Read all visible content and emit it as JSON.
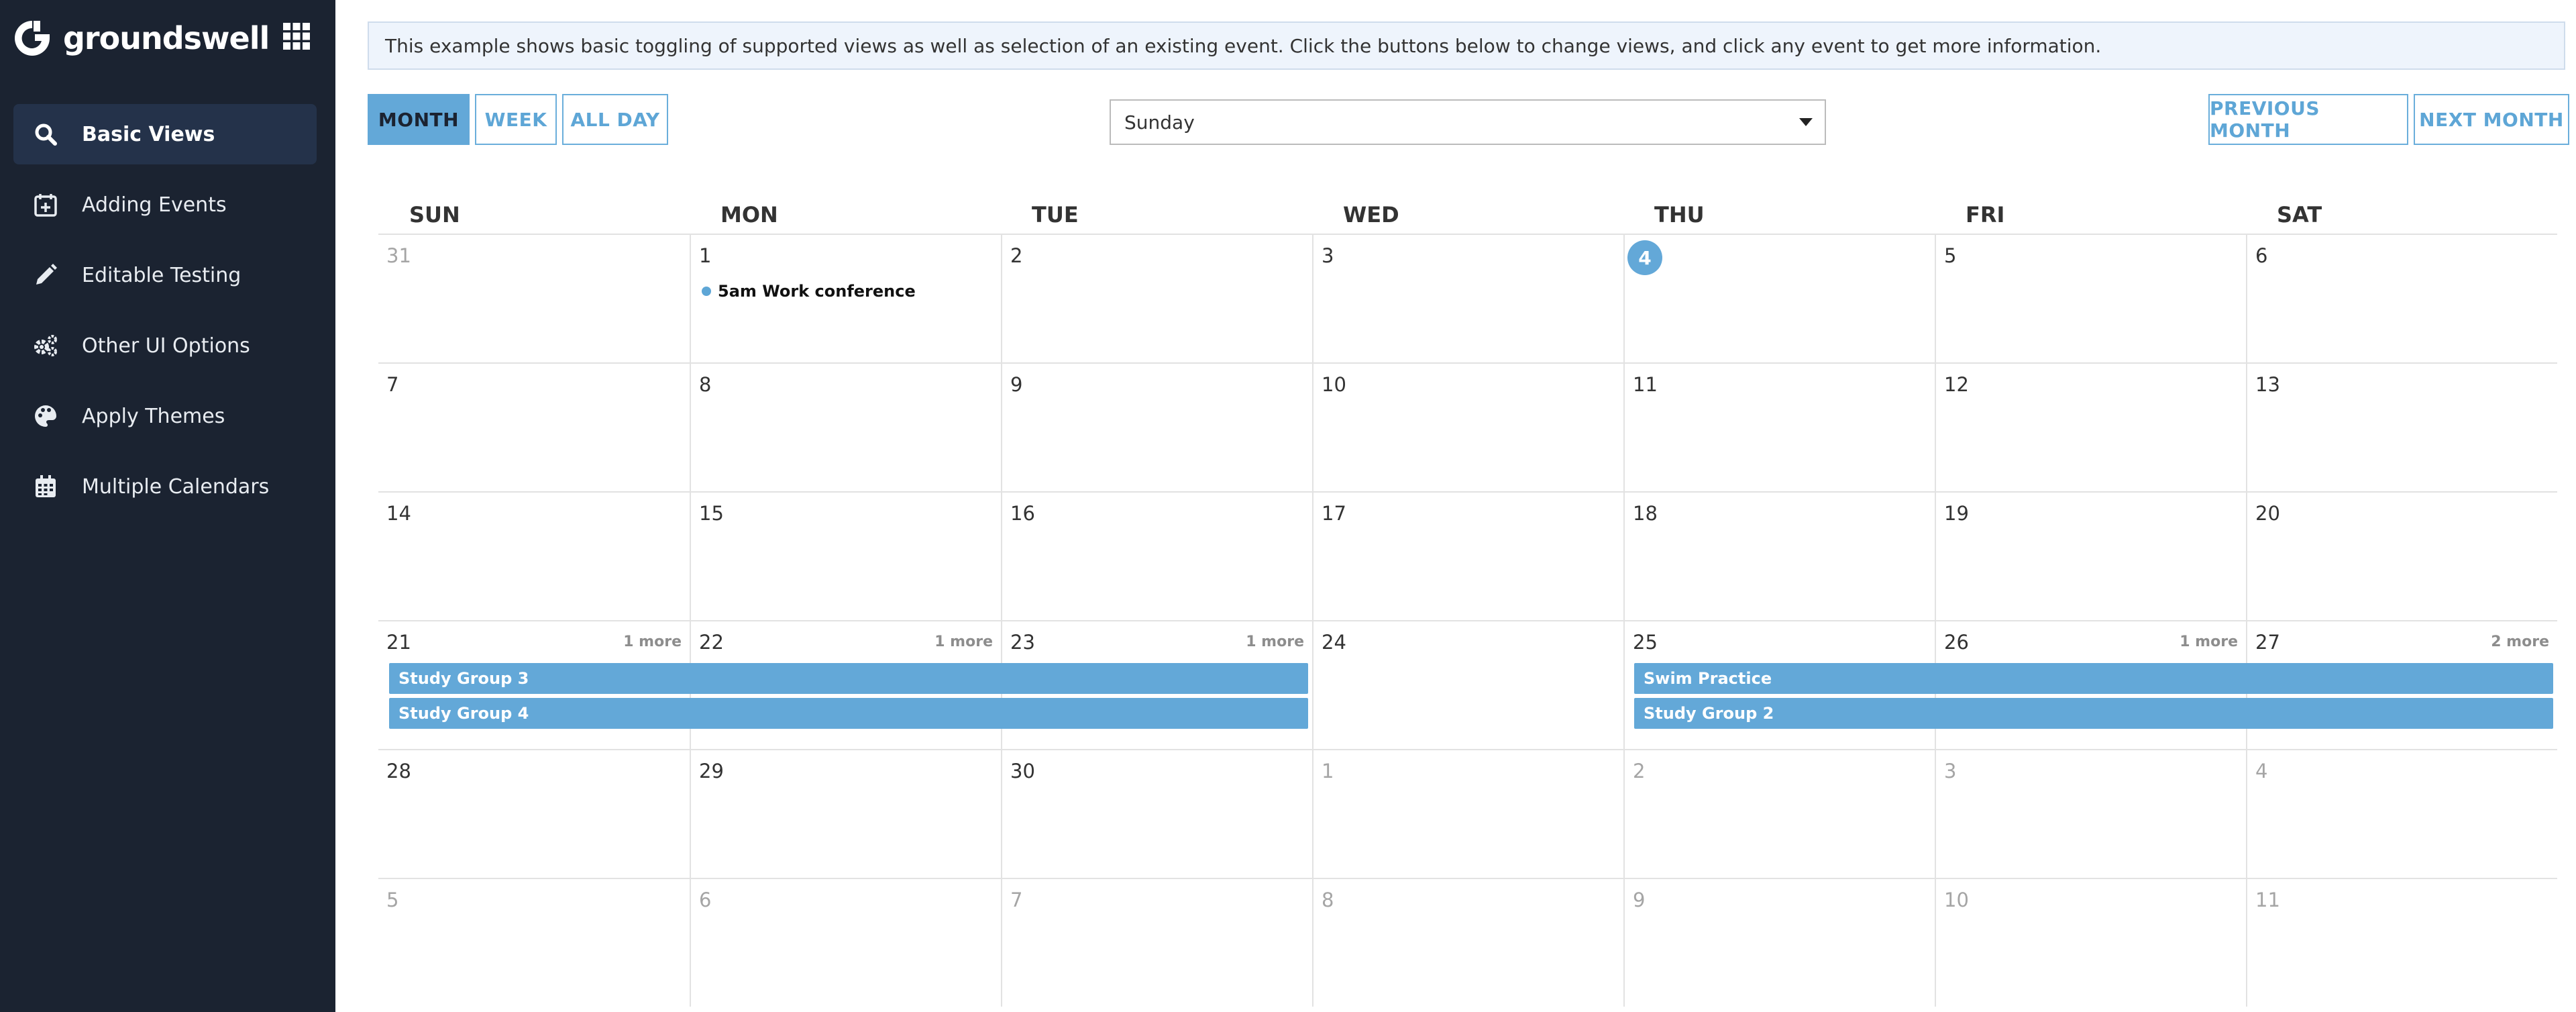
{
  "sidebar": {
    "brand": "groundswell",
    "items": [
      {
        "label": "Basic Views",
        "icon": "search-icon",
        "active": true
      },
      {
        "label": "Adding Events",
        "icon": "calendar-plus-icon",
        "active": false
      },
      {
        "label": "Editable Testing",
        "icon": "pencil-icon",
        "active": false
      },
      {
        "label": "Other UI Options",
        "icon": "gears-icon",
        "active": false
      },
      {
        "label": "Apply Themes",
        "icon": "palette-icon",
        "active": false
      },
      {
        "label": "Multiple Calendars",
        "icon": "calendar-icon",
        "active": false
      }
    ]
  },
  "info_text": "This example shows basic toggling of supported views as well as selection of an existing event. Click the buttons below to change views, and click any event to get more information.",
  "view_buttons": {
    "month": "MONTH",
    "week": "WEEK",
    "all_day": "ALL DAY"
  },
  "nav_buttons": {
    "previous": "PREVIOUS MONTH",
    "next": "NEXT MONTH"
  },
  "week_start_select": {
    "value": "Sunday"
  },
  "calendar": {
    "days_of_week": [
      "SUN",
      "MON",
      "TUE",
      "WED",
      "THU",
      "FRI",
      "SAT"
    ],
    "weeks": [
      [
        {
          "d": "31",
          "muted": true
        },
        {
          "d": "1"
        },
        {
          "d": "2"
        },
        {
          "d": "3"
        },
        {
          "d": "4",
          "today": true
        },
        {
          "d": "5"
        },
        {
          "d": "6"
        }
      ],
      [
        {
          "d": "7"
        },
        {
          "d": "8"
        },
        {
          "d": "9"
        },
        {
          "d": "10"
        },
        {
          "d": "11"
        },
        {
          "d": "12"
        },
        {
          "d": "13"
        }
      ],
      [
        {
          "d": "14"
        },
        {
          "d": "15"
        },
        {
          "d": "16"
        },
        {
          "d": "17"
        },
        {
          "d": "18"
        },
        {
          "d": "19"
        },
        {
          "d": "20"
        }
      ],
      [
        {
          "d": "21",
          "more": "1 more"
        },
        {
          "d": "22",
          "more": "1 more"
        },
        {
          "d": "23",
          "more": "1 more"
        },
        {
          "d": "24"
        },
        {
          "d": "25"
        },
        {
          "d": "26",
          "more": "1 more"
        },
        {
          "d": "27",
          "more": "2 more"
        }
      ],
      [
        {
          "d": "28"
        },
        {
          "d": "29"
        },
        {
          "d": "30"
        },
        {
          "d": "1",
          "muted": true
        },
        {
          "d": "2",
          "muted": true
        },
        {
          "d": "3",
          "muted": true
        },
        {
          "d": "4",
          "muted": true
        }
      ],
      [
        {
          "d": "5",
          "muted": true
        },
        {
          "d": "6",
          "muted": true
        },
        {
          "d": "7",
          "muted": true
        },
        {
          "d": "8",
          "muted": true
        },
        {
          "d": "9",
          "muted": true
        },
        {
          "d": "10",
          "muted": true
        },
        {
          "d": "11",
          "muted": true
        }
      ]
    ],
    "dot_events": [
      {
        "week": 0,
        "day": 1,
        "label": "5am Work conference"
      }
    ],
    "bar_events": [
      {
        "week": 3,
        "start": 0,
        "end": 2,
        "row": 0,
        "label": "Study Group 3"
      },
      {
        "week": 3,
        "start": 0,
        "end": 2,
        "row": 1,
        "label": "Study Group 4"
      },
      {
        "week": 3,
        "start": 4,
        "end": 6,
        "row": 0,
        "label": "Swim Practice"
      },
      {
        "week": 3,
        "start": 4,
        "end": 6,
        "row": 1,
        "label": "Study Group 2"
      }
    ],
    "colors": {
      "accent": "#63a8d8",
      "sidebar": "#1b2331"
    }
  }
}
